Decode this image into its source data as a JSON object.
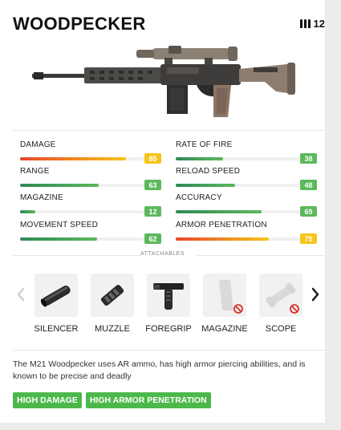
{
  "weapon": {
    "name": "WOODPECKER",
    "ammo_icon": "ammo-icon",
    "ammo_count": "12"
  },
  "stats_left": [
    {
      "label": "DAMAGE",
      "value": "85",
      "fill": 0.85,
      "bar_color": "gradient-red-yellow",
      "badge_color": "#f5c518"
    },
    {
      "label": "RANGE",
      "value": "63",
      "fill": 0.63,
      "bar_color": "gradient-green",
      "badge_color": "#5cb85c"
    },
    {
      "label": "MAGAZINE",
      "value": "12",
      "fill": 0.12,
      "bar_color": "gradient-green",
      "badge_color": "#5cb85c"
    },
    {
      "label": "MOVEMENT SPEED",
      "value": "62",
      "fill": 0.62,
      "bar_color": "gradient-green",
      "badge_color": "#5cb85c"
    }
  ],
  "stats_right": [
    {
      "label": "RATE OF FIRE",
      "value": "38",
      "fill": 0.38,
      "bar_color": "gradient-green",
      "badge_color": "#5cb85c"
    },
    {
      "label": "RELOAD SPEED",
      "value": "48",
      "fill": 0.48,
      "bar_color": "gradient-green",
      "badge_color": "#5cb85c"
    },
    {
      "label": "ACCURACY",
      "value": "69",
      "fill": 0.69,
      "bar_color": "gradient-green",
      "badge_color": "#5cb85c"
    },
    {
      "label": "ARMOR PENETRATION",
      "value": "75",
      "fill": 0.75,
      "bar_color": "gradient-red-yellow",
      "badge_color": "#f5c518"
    }
  ],
  "attachables": {
    "title": "ATTACHABLES",
    "items": [
      {
        "name": "SILENCER",
        "icon": "silencer-icon",
        "available": true
      },
      {
        "name": "MUZZLE",
        "icon": "muzzle-icon",
        "available": true
      },
      {
        "name": "FOREGRIP",
        "icon": "foregrip-icon",
        "available": true
      },
      {
        "name": "MAGAZINE",
        "icon": "magazine-icon",
        "available": false
      },
      {
        "name": "SCOPE",
        "icon": "scope-icon",
        "available": false
      }
    ]
  },
  "description": "The M21 Woodpecker uses AR ammo, has high armor piercing abilities, and is known to be precise and deadly",
  "tags": [
    "HIGH DAMAGE",
    "HIGH ARMOR PENETRATION"
  ],
  "colors": {
    "green": "#5cb85c",
    "yellow": "#f5c518",
    "red": "#e8452c",
    "tag_green": "#4cb84c"
  }
}
